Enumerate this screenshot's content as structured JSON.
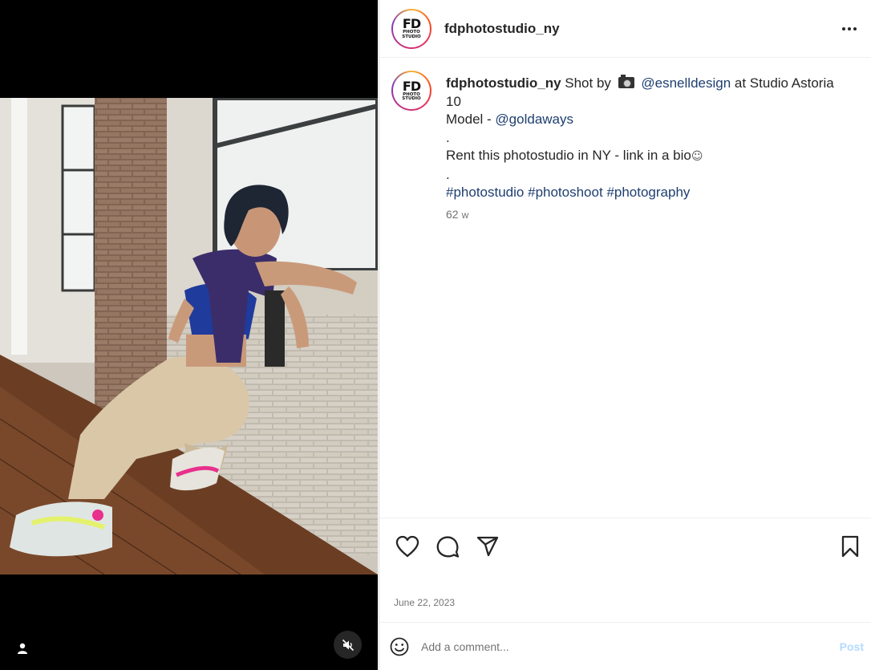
{
  "post": {
    "username": "fdphotostudio_ny",
    "avatar": {
      "line1": "FD",
      "line2": "PHOTO",
      "line3": "STUDIO"
    },
    "more_icon": "more-horizontal-icon"
  },
  "caption": {
    "username": "fdphotostudio_ny",
    "shot_by": "Shot by",
    "camera_icon": "camera-emoji",
    "photographer": "@esnelldesign",
    "location": "at Studio Astoria 10",
    "model_label": "Model -",
    "model": "@goldaways",
    "dot1": ".",
    "rent_text": "Rent this photostudio in NY - link in a bio",
    "smile": "☺",
    "dot2": ".",
    "hashtags": [
      "#photostudio",
      "#photoshoot",
      "#photography"
    ],
    "time_ago_value": "62",
    "time_ago_unit": "w"
  },
  "actions": {
    "icons": [
      "heart-icon",
      "comment-icon",
      "share-icon",
      "bookmark-icon"
    ],
    "date": "June 22, 2023"
  },
  "comment_box": {
    "placeholder": "Add a comment...",
    "post_label": "Post"
  },
  "colors": {
    "link": "#1e3f70",
    "muted": "#737373",
    "post_disabled": "#b3dbff",
    "text": "#262626"
  }
}
